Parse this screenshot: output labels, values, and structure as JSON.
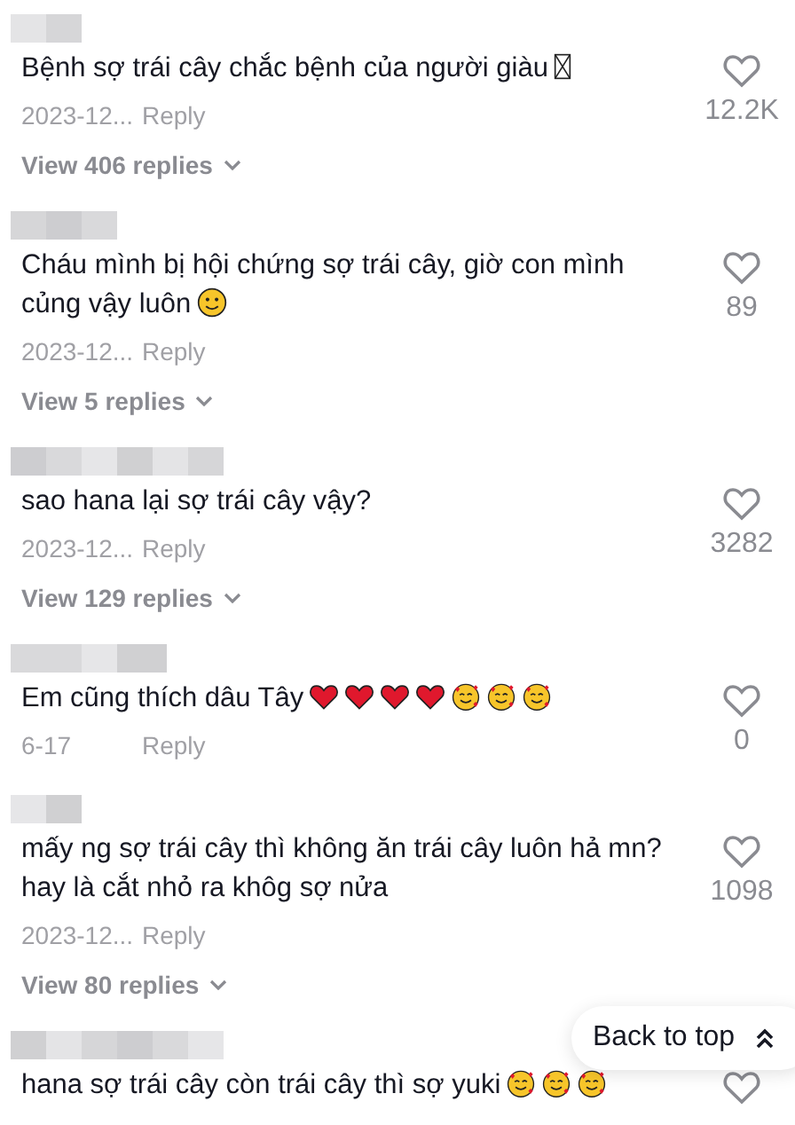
{
  "comments": [
    {
      "text": "Bệnh sợ trái cây chắc bệnh của người giàu",
      "emojis": [
        {
          "kind": "missing"
        }
      ],
      "date": "2023-12...",
      "reply": "Reply",
      "likes": "12.2K",
      "view_replies": "View 406 replies"
    },
    {
      "text": "Cháu mình bị hội chứng sợ trái cây, giờ con mình củng vậy luôn",
      "emojis": [
        {
          "kind": "smile"
        }
      ],
      "date": "2023-12...",
      "reply": "Reply",
      "likes": "89",
      "view_replies": "View 5 replies"
    },
    {
      "text": "sao hana lại sợ trái cây vậy?",
      "date": "2023-12...",
      "reply": "Reply",
      "likes": "3282",
      "view_replies": "View 129 replies"
    },
    {
      "text": "Em cũng thích dâu Tây",
      "emojis": [
        {
          "kind": "heart"
        },
        {
          "kind": "heart"
        },
        {
          "kind": "heart"
        },
        {
          "kind": "heart"
        },
        {
          "kind": "love"
        },
        {
          "kind": "love"
        },
        {
          "kind": "love"
        }
      ],
      "date": "6-17",
      "reply": "Reply",
      "likes": "0"
    },
    {
      "text": "mấy ng sợ trái cây thì không ăn trái cây luôn hả mn? hay là cắt nhỏ ra khôg sợ nửa",
      "date": "2023-12...",
      "reply": "Reply",
      "likes": "1098",
      "view_replies": "View 80 replies"
    },
    {
      "text": "hana sợ trái cây còn trái cây thì sợ yuki",
      "emojis": [
        {
          "kind": "love"
        },
        {
          "kind": "love"
        },
        {
          "kind": "love"
        }
      ]
    }
  ],
  "back_to_top": "Back to top"
}
